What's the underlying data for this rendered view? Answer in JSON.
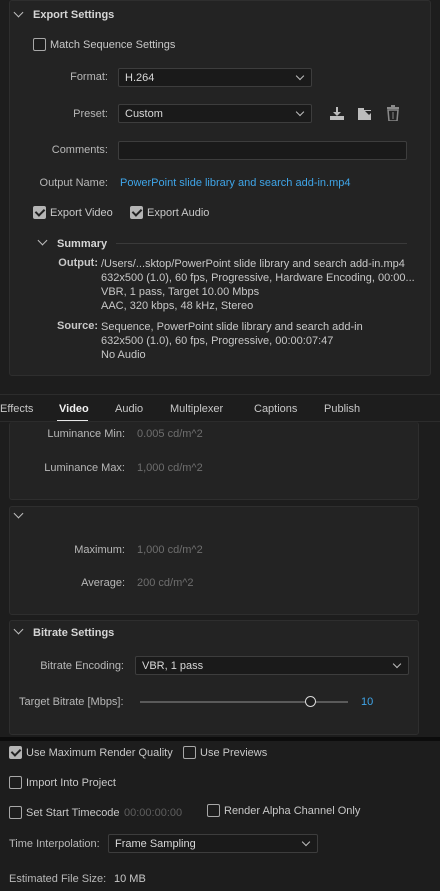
{
  "export_settings": {
    "header": "Export Settings",
    "match_sequence": {
      "label": "Match Sequence Settings",
      "checked": false
    },
    "format": {
      "label": "Format:",
      "value": "H.264"
    },
    "preset": {
      "label": "Preset:",
      "value": "Custom"
    },
    "comments": {
      "label": "Comments:",
      "value": ""
    },
    "output_name": {
      "label": "Output Name:",
      "value": "PowerPoint slide library and search add-in.mp4"
    },
    "export_video": {
      "label": "Export Video",
      "checked": true
    },
    "export_audio": {
      "label": "Export Audio",
      "checked": true
    },
    "summary": {
      "header": "Summary",
      "output_key": "Output:",
      "output_lines": [
        "/Users/...sktop/PowerPoint slide library and search add-in.mp4",
        "632x500 (1.0), 60 fps, Progressive, Hardware Encoding, 00:00...",
        "VBR, 1 pass, Target 10.00 Mbps",
        "AAC, 320 kbps, 48 kHz, Stereo"
      ],
      "source_key": "Source:",
      "source_lines": [
        "Sequence, PowerPoint slide library and search add-in",
        "632x500 (1.0), 60 fps, Progressive, 00:00:07:47",
        "No Audio"
      ]
    }
  },
  "tabs": [
    "Effects",
    "Video",
    "Audio",
    "Multiplexer",
    "Captions",
    "Publish"
  ],
  "active_tab": "Video",
  "luminance": {
    "min_label": "Luminance Min:",
    "min_value": "0.005 cd/m^2",
    "max_label": "Luminance Max:",
    "max_value": "1,000 cd/m^2"
  },
  "mastering": {
    "max_label": "Maximum:",
    "max_value": "1,000 cd/m^2",
    "avg_label": "Average:",
    "avg_value": "200 cd/m^2"
  },
  "bitrate": {
    "header": "Bitrate Settings",
    "encoding_label": "Bitrate Encoding:",
    "encoding_value": "VBR, 1 pass",
    "target_label": "Target Bitrate [Mbps]:",
    "target_value": "10",
    "slider_fraction": 0.82
  },
  "bottom": {
    "max_render_quality": {
      "label": "Use Maximum Render Quality",
      "checked": true
    },
    "use_previews": {
      "label": "Use Previews",
      "checked": false
    },
    "import_into_project": {
      "label": "Import Into Project",
      "checked": false
    },
    "set_start_timecode": {
      "label": "Set Start Timecode",
      "checked": false,
      "value": "00:00:00:00"
    },
    "render_alpha": {
      "label": "Render Alpha Channel Only",
      "checked": false
    },
    "time_interpolation": {
      "label": "Time Interpolation:",
      "value": "Frame Sampling"
    },
    "estimated_size": {
      "label": "Estimated File Size:",
      "value": "10 MB"
    }
  },
  "colors": {
    "accent": "#3fa5e8",
    "background": "#1d1d1d",
    "panel": "#232323"
  }
}
